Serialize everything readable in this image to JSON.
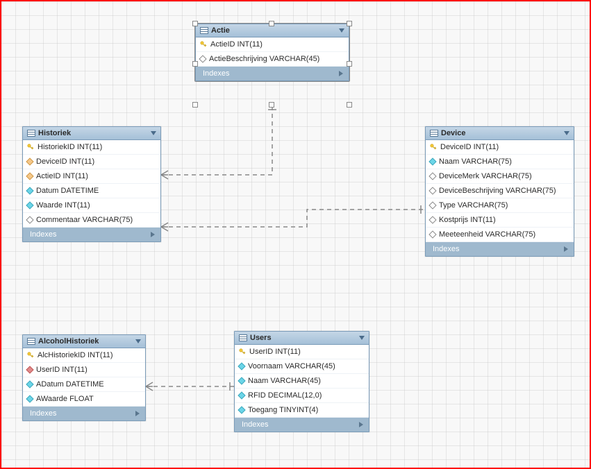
{
  "indexes_label": "Indexes",
  "tables": {
    "actie": {
      "title": "Actie",
      "columns": [
        {
          "icon": "key",
          "text": "ActieID INT(11)"
        },
        {
          "icon": "diamond",
          "text": "ActieBeschrijving VARCHAR(45)"
        }
      ]
    },
    "historiek": {
      "title": "Historiek",
      "columns": [
        {
          "icon": "key",
          "text": "HistoriekID INT(11)"
        },
        {
          "icon": "diamond-orange",
          "text": "DeviceID INT(11)"
        },
        {
          "icon": "diamond-orange",
          "text": "ActieID INT(11)"
        },
        {
          "icon": "diamond-cyan",
          "text": "Datum DATETIME"
        },
        {
          "icon": "diamond-cyan",
          "text": "Waarde INT(11)"
        },
        {
          "icon": "diamond",
          "text": "Commentaar VARCHAR(75)"
        }
      ]
    },
    "device": {
      "title": "Device",
      "columns": [
        {
          "icon": "key",
          "text": "DeviceID INT(11)"
        },
        {
          "icon": "diamond-cyan",
          "text": "Naam VARCHAR(75)"
        },
        {
          "icon": "diamond",
          "text": "DeviceMerk VARCHAR(75)"
        },
        {
          "icon": "diamond",
          "text": "DeviceBeschrijving VARCHAR(75)"
        },
        {
          "icon": "diamond",
          "text": "Type VARCHAR(75)"
        },
        {
          "icon": "diamond",
          "text": "Kostprijs INT(11)"
        },
        {
          "icon": "diamond",
          "text": "Meeteenheid VARCHAR(75)"
        }
      ]
    },
    "alcohol": {
      "title": "AlcoholHistoriek",
      "columns": [
        {
          "icon": "key",
          "text": "AlcHistoriekID INT(11)"
        },
        {
          "icon": "diamond-red",
          "text": "UserID INT(11)"
        },
        {
          "icon": "diamond-cyan",
          "text": "ADatum DATETIME"
        },
        {
          "icon": "diamond-cyan",
          "text": "AWaarde FLOAT"
        }
      ]
    },
    "users": {
      "title": "Users",
      "columns": [
        {
          "icon": "key",
          "text": "UserID INT(11)"
        },
        {
          "icon": "diamond-cyan",
          "text": "Voornaam VARCHAR(45)"
        },
        {
          "icon": "diamond-cyan",
          "text": "Naam VARCHAR(45)"
        },
        {
          "icon": "diamond-cyan",
          "text": "RFID DECIMAL(12,0)"
        },
        {
          "icon": "diamond-cyan",
          "text": "Toegang TINYINT(4)"
        }
      ]
    }
  }
}
